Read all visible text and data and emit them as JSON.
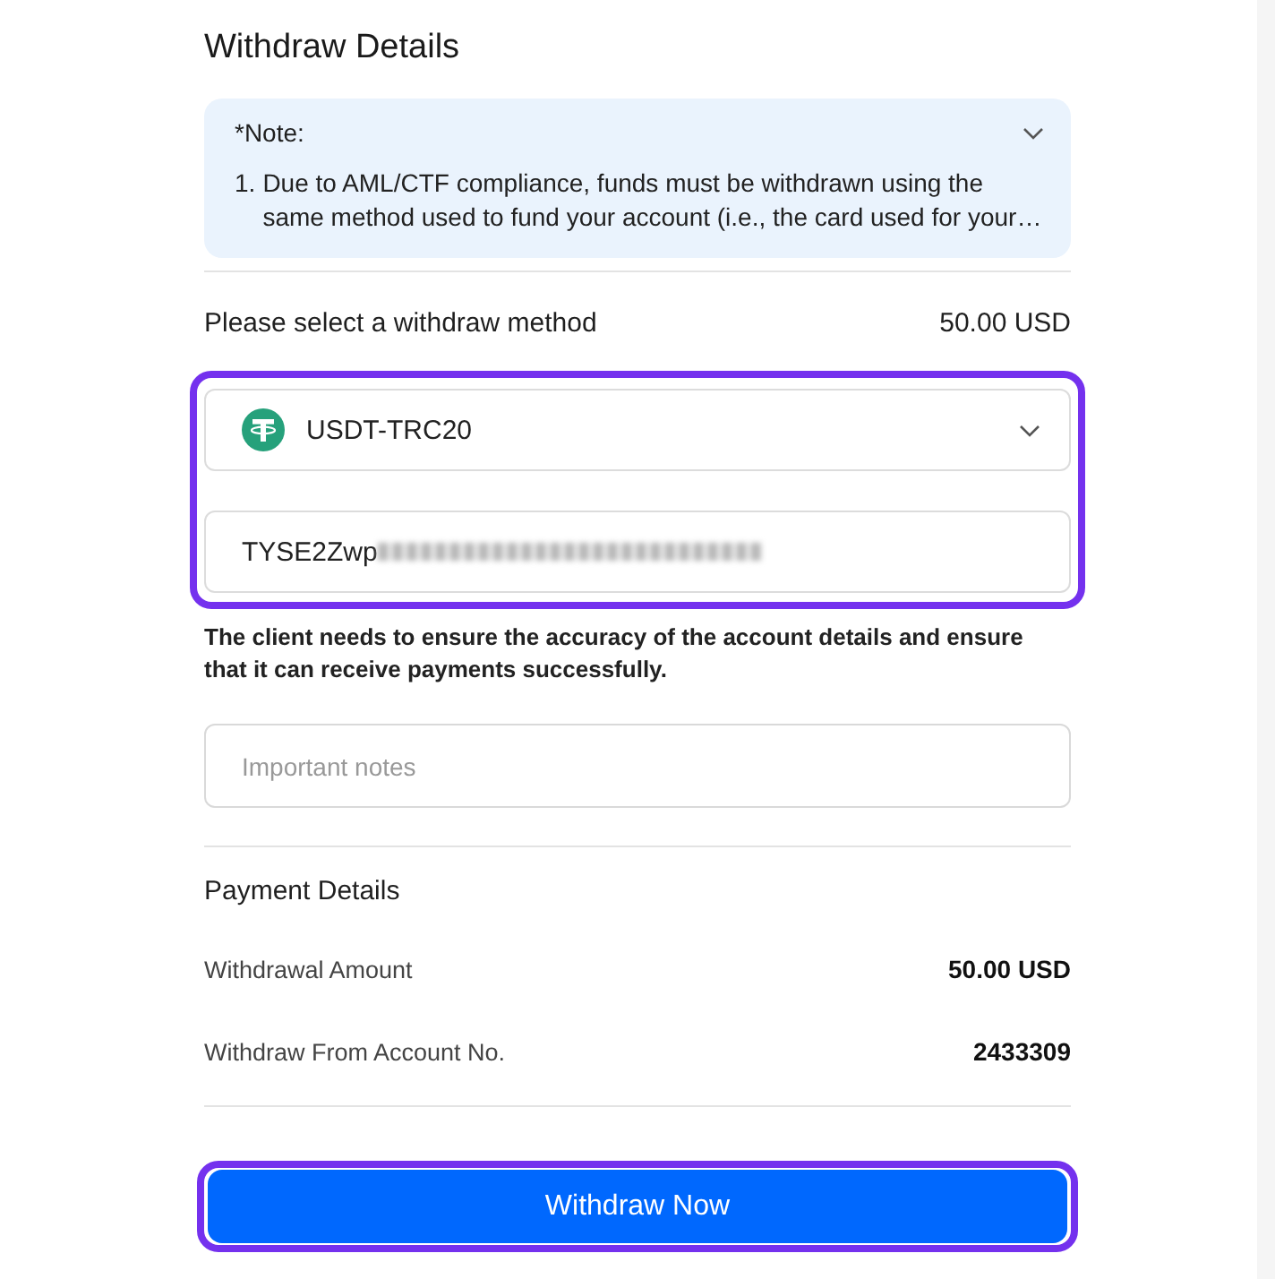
{
  "page": {
    "title": "Withdraw Details"
  },
  "note": {
    "title": "*Note:",
    "items": [
      {
        "number": "1.",
        "text": "Due to AML/CTF compliance, funds must be withdrawn using the same method used to fund your account (i.e., the card used for your…"
      }
    ]
  },
  "method": {
    "label": "Please select a withdraw method",
    "amount": "50.00 USD",
    "highlighted": true,
    "select": {
      "value": "USDT-TRC20"
    },
    "address": {
      "value": "TYSE2Zwp",
      "redacted": true
    }
  },
  "disclaimer": "The client needs to ensure the accuracy of the account details and ensure that it can receive payments successfully.",
  "notes_field": {
    "placeholder": "Important notes"
  },
  "payment_details": {
    "title": "Payment Details",
    "rows": [
      {
        "label": "Withdrawal Amount",
        "value": "50.00 USD"
      },
      {
        "label": "Withdraw From Account No.",
        "value": "2433309"
      }
    ]
  },
  "submit": {
    "label": "Withdraw Now",
    "highlighted": true
  }
}
